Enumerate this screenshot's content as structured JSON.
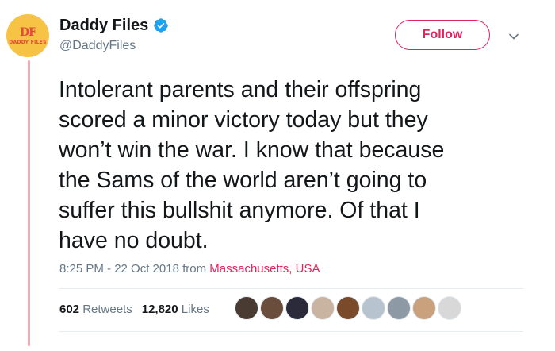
{
  "account": {
    "display_name": "Daddy Files",
    "handle": "@DaddyFiles",
    "avatar_mark": "DF",
    "avatar_text": "DADDY FILES",
    "verified_icon": "verified-badge-icon"
  },
  "actions": {
    "follow_label": "Follow",
    "menu_icon": "chevron-down-icon"
  },
  "tweet": {
    "text": "Intolerant parents and their offspring\nscored a minor victory today but they\nwon’t win the war. I know that because\nthe Sams of the world aren’t going to\nsuffer this bullshit anymore. Of that I\nhave no doubt.",
    "timestamp": "8:25 PM - 22 Oct 2018",
    "from_label": "from",
    "location": "Massachusetts, USA"
  },
  "stats": {
    "retweets_count": "602",
    "retweets_label": "Retweets",
    "likes_count": "12,820",
    "likes_label": "Likes"
  },
  "liker_avatars": [
    {
      "name": "liker-avatar-1",
      "color": "#4a3b32"
    },
    {
      "name": "liker-avatar-2",
      "color": "#6b4d3b"
    },
    {
      "name": "liker-avatar-3",
      "color": "#2b2a3a"
    },
    {
      "name": "liker-avatar-4",
      "color": "#c9b3a1"
    },
    {
      "name": "liker-avatar-5",
      "color": "#7a4a2b"
    },
    {
      "name": "liker-avatar-6",
      "color": "#b7c4cf"
    },
    {
      "name": "liker-avatar-7",
      "color": "#8d9aa5"
    },
    {
      "name": "liker-avatar-8",
      "color": "#c9a27d"
    },
    {
      "name": "liker-avatar-9",
      "color": "#d8d8d8"
    }
  ],
  "colors": {
    "accent": "#e0245e",
    "thread_line": "#f3a8b6",
    "muted_text": "#657786",
    "verified": "#1da1f2",
    "avatar_bg": "#f6c344"
  }
}
